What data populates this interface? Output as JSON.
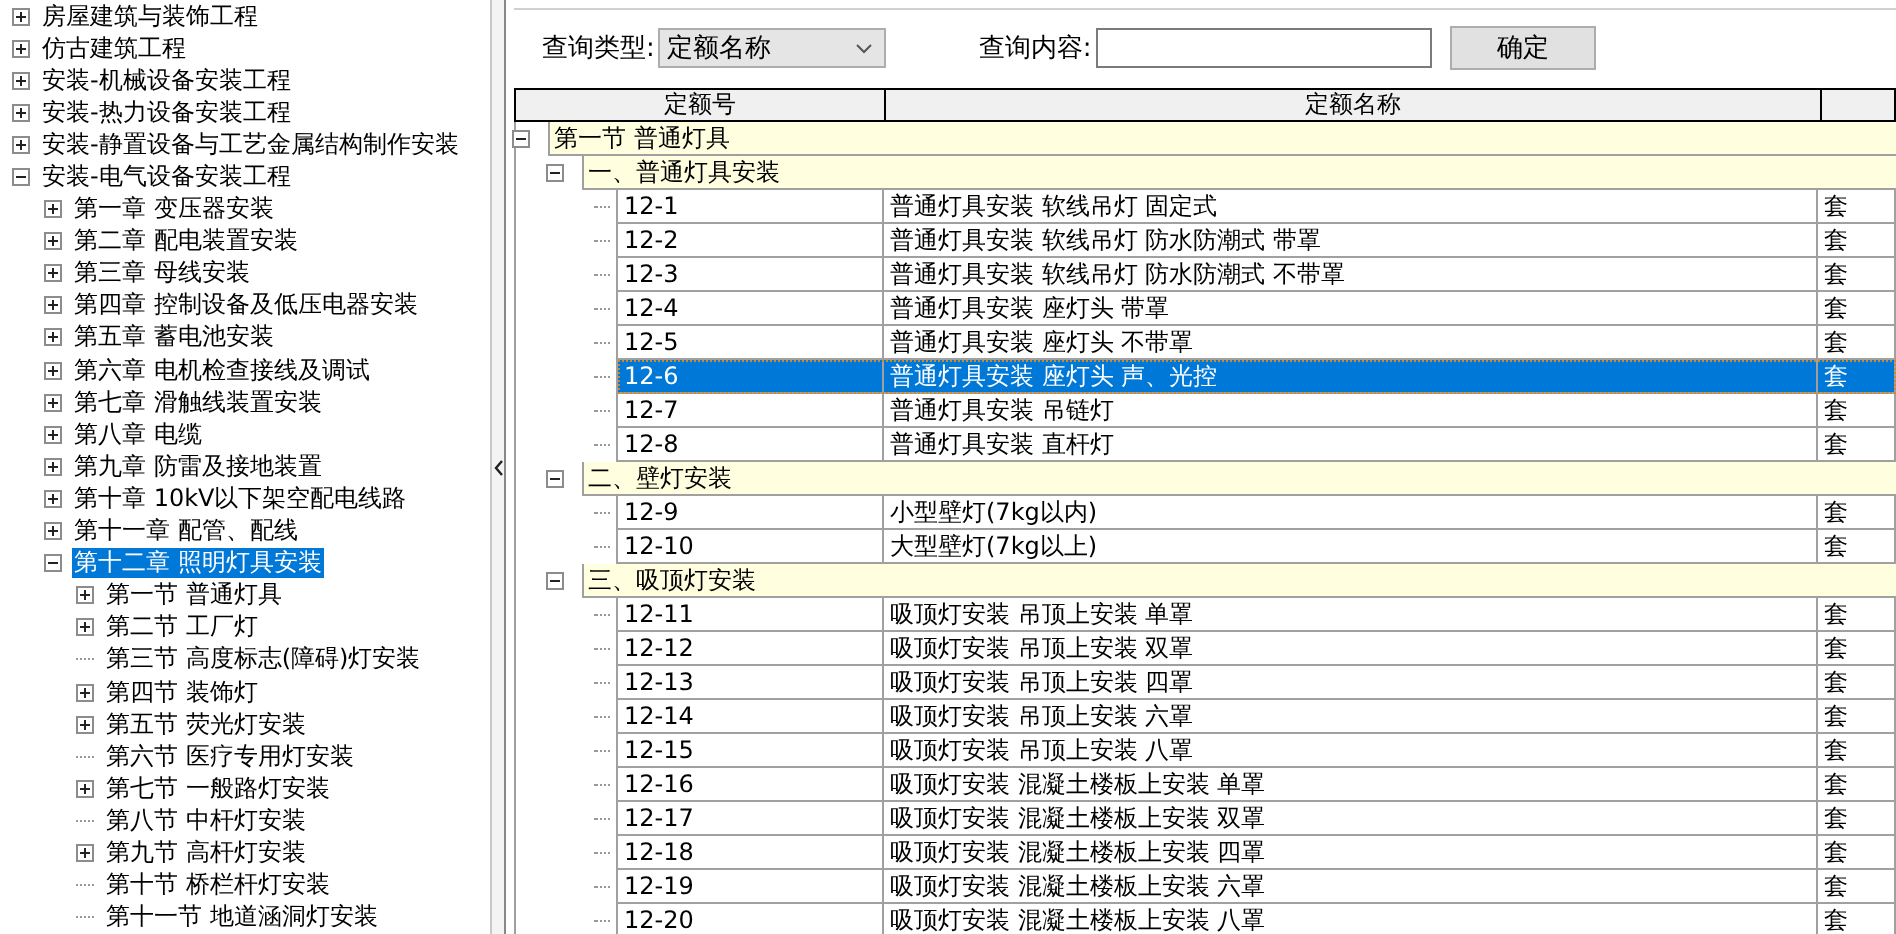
{
  "tree": [
    {
      "label": "房屋建筑与装饰工程",
      "kind": "node",
      "expanded": false,
      "selected": false
    },
    {
      "label": "仿古建筑工程",
      "kind": "node",
      "expanded": false,
      "selected": false
    },
    {
      "label": "安装-机械设备安装工程",
      "kind": "node",
      "expanded": false,
      "selected": false
    },
    {
      "label": "安装-热力设备安装工程",
      "kind": "node",
      "expanded": false,
      "selected": false
    },
    {
      "label": "安装-静置设备与工艺金属结构制作安装",
      "kind": "node",
      "expanded": false,
      "selected": false
    },
    {
      "label": "安装-电气设备安装工程",
      "kind": "node",
      "expanded": true,
      "selected": false,
      "children": [
        {
          "label": "第一章  变压器安装",
          "kind": "node",
          "expanded": false,
          "selected": false
        },
        {
          "label": "第二章  配电装置安装",
          "kind": "node",
          "expanded": false,
          "selected": false
        },
        {
          "label": "第三章  母线安装",
          "kind": "node",
          "expanded": false,
          "selected": false
        },
        {
          "label": "第四章  控制设备及低压电器安装",
          "kind": "node",
          "expanded": false,
          "selected": false
        },
        {
          "label": "第五章  蓄电池安装",
          "kind": "node",
          "expanded": false,
          "selected": false
        },
        {
          "label": "第六章  电机检查接线及调试",
          "kind": "node",
          "expanded": false,
          "selected": false
        },
        {
          "label": "第七章  滑触线装置安装",
          "kind": "node",
          "expanded": false,
          "selected": false
        },
        {
          "label": "第八章  电缆",
          "kind": "node",
          "expanded": false,
          "selected": false
        },
        {
          "label": "第九章  防雷及接地装置",
          "kind": "node",
          "expanded": false,
          "selected": false
        },
        {
          "label": "第十章  10kV以下架空配电线路",
          "kind": "node",
          "expanded": false,
          "selected": false
        },
        {
          "label": "第十一章  配管、配线",
          "kind": "node",
          "expanded": false,
          "selected": false
        },
        {
          "label": "第十二章  照明灯具安装",
          "kind": "node",
          "expanded": true,
          "selected": true,
          "children": [
            {
              "label": "第一节  普通灯具",
              "kind": "node",
              "expanded": false,
              "selected": false
            },
            {
              "label": "第二节  工厂灯",
              "kind": "node",
              "expanded": false,
              "selected": false
            },
            {
              "label": "第三节  高度标志(障碍)灯安装",
              "kind": "leaf",
              "selected": false
            },
            {
              "label": "第四节  装饰灯",
              "kind": "node",
              "expanded": false,
              "selected": false
            },
            {
              "label": "第五节  荧光灯安装",
              "kind": "node",
              "expanded": false,
              "selected": false
            },
            {
              "label": "第六节  医疗专用灯安装",
              "kind": "leaf",
              "selected": false
            },
            {
              "label": "第七节  一般路灯安装",
              "kind": "node",
              "expanded": false,
              "selected": false
            },
            {
              "label": "第八节  中杆灯安装",
              "kind": "leaf",
              "selected": false
            },
            {
              "label": "第九节  高杆灯安装",
              "kind": "node",
              "expanded": false,
              "selected": false
            },
            {
              "label": "第十节  桥栏杆灯安装",
              "kind": "leaf",
              "selected": false
            },
            {
              "label": "第十一节  地道涵洞灯安装",
              "kind": "leaf",
              "selected": false
            }
          ]
        }
      ]
    }
  ],
  "query": {
    "type_label": "查询类型:",
    "type_value": "定额名称",
    "content_label": "查询内容:",
    "button": "确定"
  },
  "table": {
    "columns": [
      "定额号",
      "定额名称"
    ],
    "sections": [
      {
        "label": "第一节  普通灯具",
        "expanded": true,
        "groups": [
          {
            "label": "一、普通灯具安装",
            "expanded": true,
            "rows": [
              {
                "code": "12-1",
                "name": "普通灯具安装  软线吊灯  固定式",
                "unit": "套",
                "selected": false
              },
              {
                "code": "12-2",
                "name": "普通灯具安装  软线吊灯  防水防潮式  带罩",
                "unit": "套",
                "selected": false
              },
              {
                "code": "12-3",
                "name": "普通灯具安装  软线吊灯  防水防潮式  不带罩",
                "unit": "套",
                "selected": false
              },
              {
                "code": "12-4",
                "name": "普通灯具安装  座灯头  带罩",
                "unit": "套",
                "selected": false
              },
              {
                "code": "12-5",
                "name": "普通灯具安装  座灯头  不带罩",
                "unit": "套",
                "selected": false
              },
              {
                "code": "12-6",
                "name": "普通灯具安装  座灯头  声、光控",
                "unit": "套",
                "selected": true
              },
              {
                "code": "12-7",
                "name": "普通灯具安装  吊链灯",
                "unit": "套",
                "selected": false
              },
              {
                "code": "12-8",
                "name": "普通灯具安装  直杆灯",
                "unit": "套",
                "selected": false
              }
            ]
          },
          {
            "label": "二、壁灯安装",
            "expanded": true,
            "rows": [
              {
                "code": "12-9",
                "name": "小型壁灯(7kg以内)",
                "unit": "套",
                "selected": false
              },
              {
                "code": "12-10",
                "name": "大型壁灯(7kg以上)",
                "unit": "套",
                "selected": false
              }
            ]
          },
          {
            "label": "三、吸顶灯安装",
            "expanded": true,
            "rows": [
              {
                "code": "12-11",
                "name": "吸顶灯安装  吊顶上安装  单罩",
                "unit": "套",
                "selected": false
              },
              {
                "code": "12-12",
                "name": "吸顶灯安装  吊顶上安装  双罩",
                "unit": "套",
                "selected": false
              },
              {
                "code": "12-13",
                "name": "吸顶灯安装  吊顶上安装  四罩",
                "unit": "套",
                "selected": false
              },
              {
                "code": "12-14",
                "name": "吸顶灯安装  吊顶上安装  六罩",
                "unit": "套",
                "selected": false
              },
              {
                "code": "12-15",
                "name": "吸顶灯安装  吊顶上安装  八罩",
                "unit": "套",
                "selected": false
              },
              {
                "code": "12-16",
                "name": "吸顶灯安装  混凝土楼板上安装  单罩",
                "unit": "套",
                "selected": false
              },
              {
                "code": "12-17",
                "name": "吸顶灯安装  混凝土楼板上安装  双罩",
                "unit": "套",
                "selected": false
              },
              {
                "code": "12-18",
                "name": "吸顶灯安装  混凝土楼板上安装  四罩",
                "unit": "套",
                "selected": false
              },
              {
                "code": "12-19",
                "name": "吸顶灯安装  混凝土楼板上安装  六罩",
                "unit": "套",
                "selected": false
              },
              {
                "code": "12-20",
                "name": "吸顶灯安装  混凝土楼板上安装  八罩",
                "unit": "套",
                "selected": false
              }
            ]
          }
        ]
      }
    ]
  }
}
